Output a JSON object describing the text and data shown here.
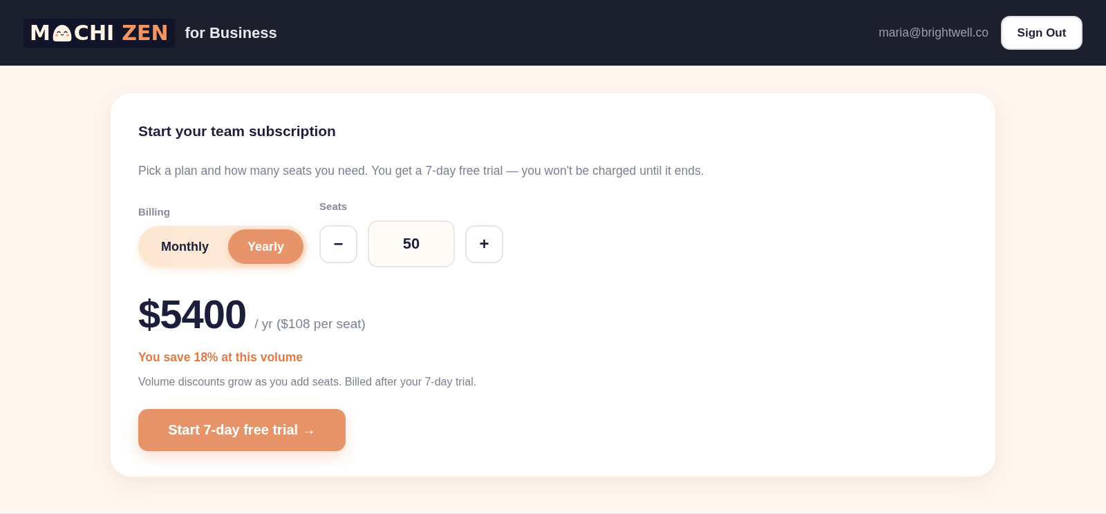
{
  "header": {
    "logo": {
      "lead": "M",
      "trail": "CHI",
      "accent": "ZEN"
    },
    "product": "for Business",
    "user_email": "maria@brightwell.co",
    "sign_out_button": "Sign Out"
  },
  "card": {
    "title": "Start your team subscription",
    "description": "Pick a plan and how many seats you need. You get a 7-day free trial — you won't be charged until it ends.",
    "billing": {
      "label": "Billing",
      "options": [
        {
          "label": "Monthly",
          "selected": false
        },
        {
          "label": "Yearly",
          "selected": true
        }
      ]
    },
    "seats": {
      "label": "Seats",
      "decrement": "−",
      "value": "50",
      "increment": "+"
    },
    "price": {
      "amount": "$5400",
      "period": "/ yr ($108 per seat)"
    },
    "savings": "You save 18% at this volume",
    "note": "Volume discounts grow as you add seats. Billed after your 7-day trial.",
    "cta_button": "Start 7-day free trial →"
  }
}
